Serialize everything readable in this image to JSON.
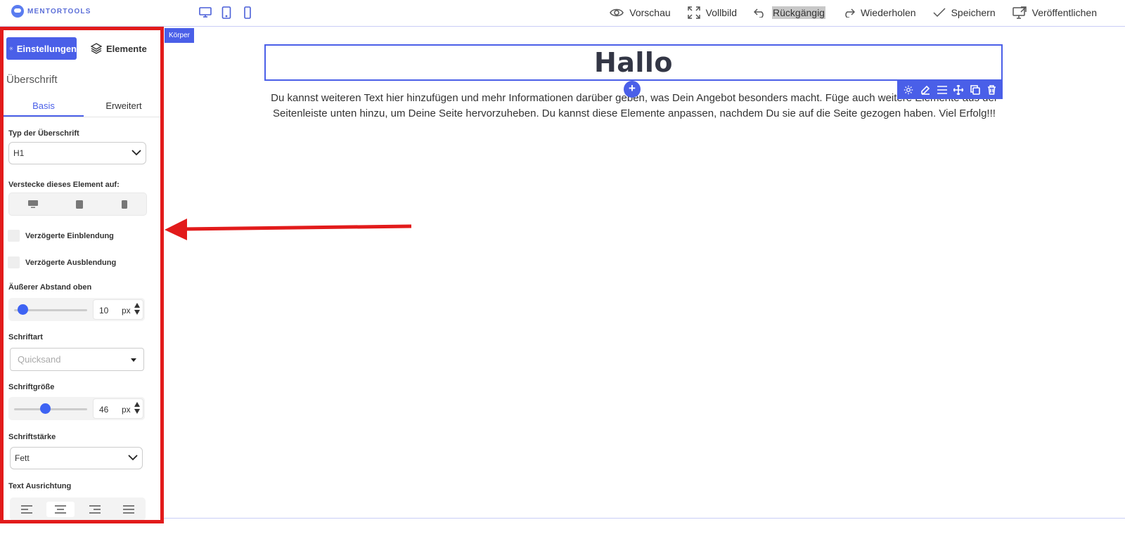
{
  "app": {
    "logo_text": "MENTORTOOLS"
  },
  "topbar": {
    "actions": [
      {
        "label": "Vorschau",
        "icon": "eye-icon"
      },
      {
        "label": "Vollbild",
        "icon": "fullscreen-icon"
      },
      {
        "label": "Rückgängig",
        "icon": "undo-icon",
        "highlighted": true
      },
      {
        "label": "Wiederholen",
        "icon": "redo-icon"
      },
      {
        "label": "Speichern",
        "icon": "check-icon"
      },
      {
        "label": "Veröffentlichen",
        "icon": "publish-icon"
      }
    ]
  },
  "panel": {
    "tabs": {
      "settings": "Einstellungen",
      "elements": "Elemente"
    },
    "section_title": "Überschrift",
    "subtabs": {
      "basic": "Basis",
      "advanced": "Erweitert"
    },
    "heading_type": {
      "label": "Typ der Überschrift",
      "value": "H1"
    },
    "hide_on": {
      "label": "Verstecke dieses Element auf:"
    },
    "delayed_show": {
      "label": "Verzögerte Einblendung",
      "checked": false
    },
    "delayed_hide": {
      "label": "Verzögerte Ausblendung",
      "checked": false
    },
    "margin_top": {
      "label": "Äußerer Abstand oben",
      "value": "10",
      "unit": "px"
    },
    "font": {
      "label": "Schriftart",
      "placeholder": "Quicksand"
    },
    "font_size": {
      "label": "Schriftgröße",
      "value": "46",
      "unit": "px"
    },
    "font_weight": {
      "label": "Schriftstärke",
      "value": "Fett"
    },
    "text_align": {
      "label": "Text Ausrichtung",
      "options": [
        "left",
        "center",
        "right",
        "justify"
      ],
      "selected": "center"
    }
  },
  "canvas": {
    "body_tag": "Körper",
    "heading": "Hallo",
    "body_text": "Du kannst weiteren Text hier hinzufügen und mehr Informationen darüber geben, was Dein Angebot besonders macht. Füge auch weitere Elemente aus der Seitenleiste unten hinzu, um Deine Seite hervorzuheben. Du kannst diese Elemente anpassen, nachdem Du sie auf die Seite gezogen haben. Viel Erfolg!!!"
  },
  "colors": {
    "accent": "#4a5fe8",
    "annotation": "#e21b1b"
  }
}
